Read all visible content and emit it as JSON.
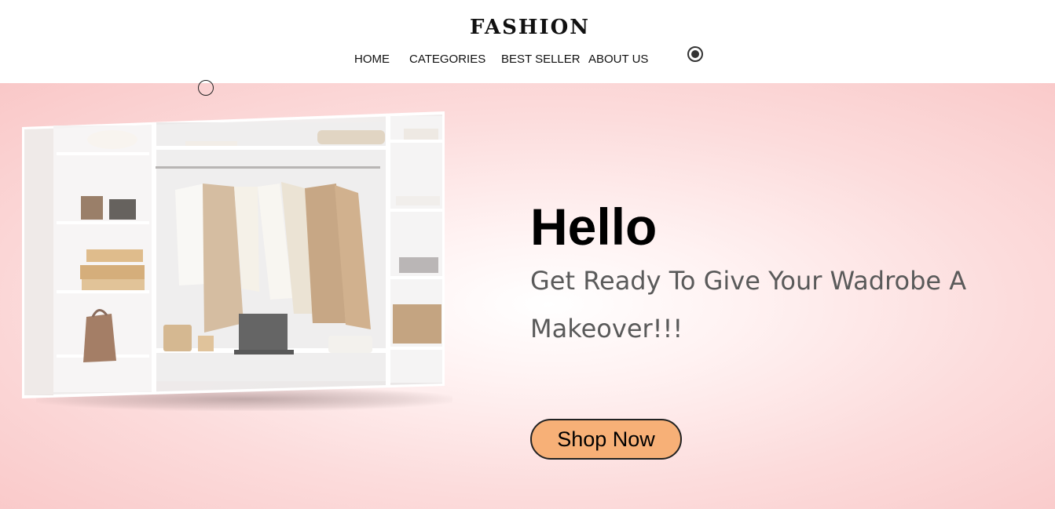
{
  "header": {
    "brand": "FASHION",
    "nav": [
      {
        "label": "HOME"
      },
      {
        "label": "CATEGORIES"
      },
      {
        "label": "BEST SELLER"
      },
      {
        "label": "ABOUT US"
      }
    ]
  },
  "hero": {
    "heading": "Hello",
    "tagline": "Get Ready To Give Your Wadrobe A Makeover!!!",
    "cta_label": "Shop Now",
    "cta_color": "#f7b077",
    "background_color": "#f9c8c8"
  },
  "icons": {
    "theme_toggle": "radio-selected-icon",
    "floating_radio": "radio-unselected-icon",
    "image": "wardrobe-photo"
  }
}
